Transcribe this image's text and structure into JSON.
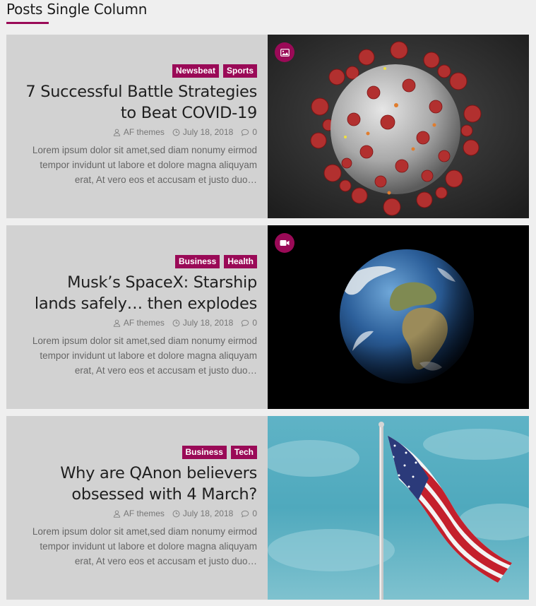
{
  "widget": {
    "title": "Posts Single Column"
  },
  "posts": [
    {
      "categories": [
        "Newsbeat",
        "Sports"
      ],
      "title_line1": "7 Successful Battle Strategies",
      "title_line2": "to Beat COVID-19",
      "author": "AF themes",
      "date": "July 18, 2018",
      "comments": "0",
      "excerpt_line1": "Lorem ipsum dolor sit amet,sed diam nonumy eirmod",
      "excerpt_line2": "tempor invidunt ut labore et dolore magna aliquyam",
      "excerpt_line3": "erat, At vero eos et accusam et justo duo…",
      "format_icon": "image-icon",
      "image_subject": "coronavirus"
    },
    {
      "categories": [
        "Business",
        "Health"
      ],
      "title_line1": "Musk’s SpaceX: Starship",
      "title_line2": "lands safely… then explodes",
      "author": "AF themes",
      "date": "July 18, 2018",
      "comments": "0",
      "excerpt_line1": "Lorem ipsum dolor sit amet,sed diam nonumy eirmod",
      "excerpt_line2": "tempor invidunt ut labore et dolore magna aliquyam",
      "excerpt_line3": "erat, At vero eos et accusam et justo duo…",
      "format_icon": "video-camera-icon",
      "image_subject": "earth"
    },
    {
      "categories": [
        "Business",
        "Tech"
      ],
      "title_line1": "Why are QAnon believers",
      "title_line2": "obsessed with 4 March?",
      "author": "AF themes",
      "date": "July 18, 2018",
      "comments": "0",
      "excerpt_line1": "Lorem ipsum dolor sit amet,sed diam nonumy eirmod",
      "excerpt_line2": "tempor invidunt ut labore et dolore magna aliquyam",
      "excerpt_line3": "erat, At vero eos et accusam et justo duo…",
      "format_icon": "",
      "image_subject": "american-flag"
    }
  ],
  "colors": {
    "accent": "#9a0a57",
    "card_bg": "#d2d2d2",
    "page_bg": "#efefef"
  }
}
